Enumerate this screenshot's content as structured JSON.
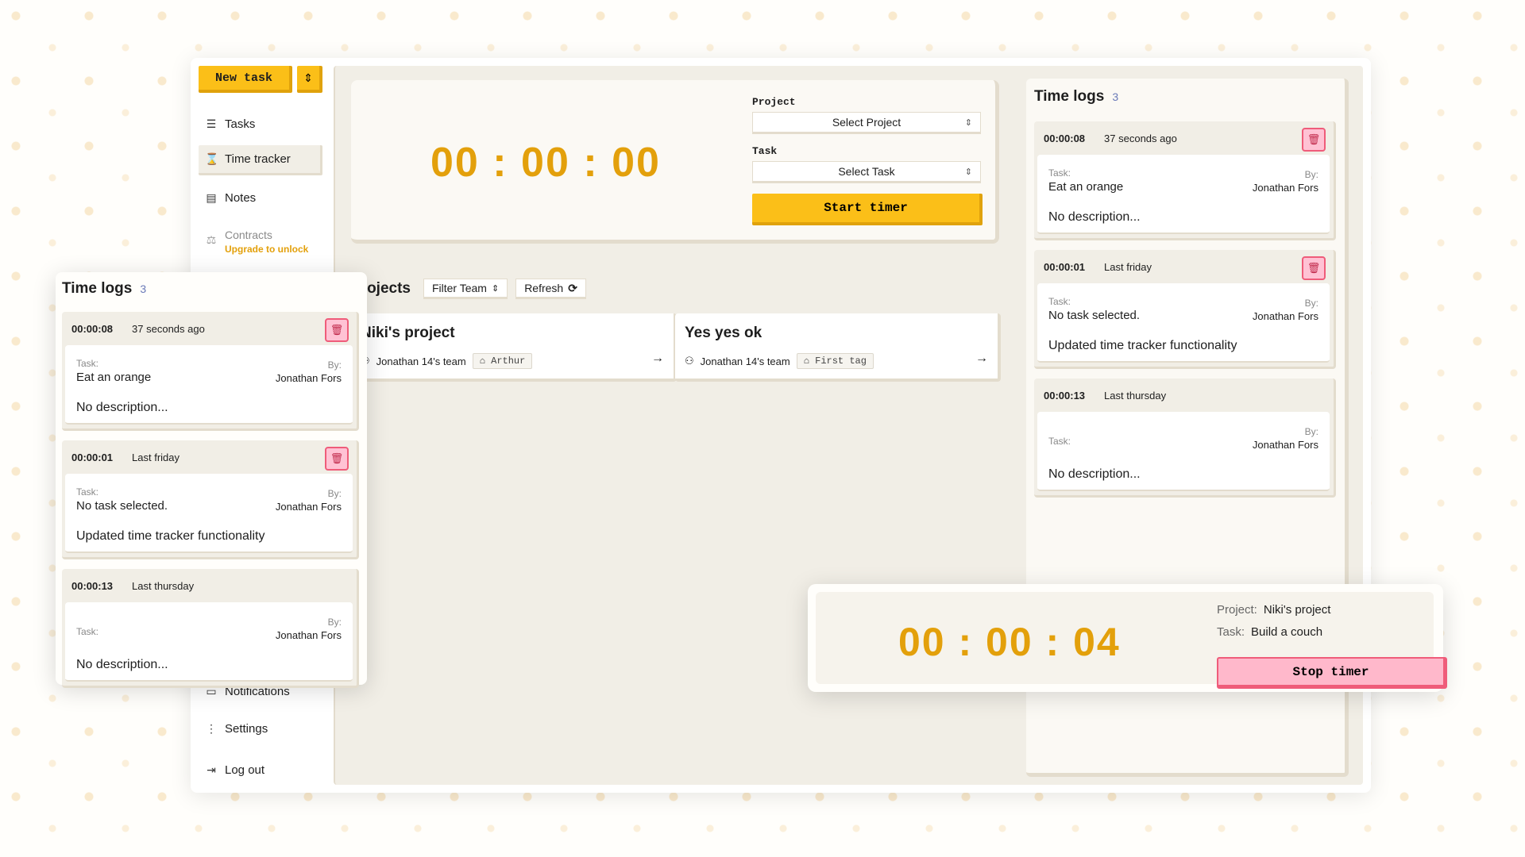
{
  "sidebar": {
    "new_task_label": "New task",
    "items": [
      {
        "label": "Tasks",
        "icon": "list-icon"
      },
      {
        "label": "Time tracker",
        "icon": "hourglass-icon"
      },
      {
        "label": "Notes",
        "icon": "notes-icon"
      },
      {
        "label": "Contracts",
        "icon": "scale-icon",
        "sublabel": "Upgrade to unlock"
      },
      {
        "label": "Notifications",
        "icon": "chat-icon"
      },
      {
        "label": "Settings",
        "icon": "dots-icon"
      },
      {
        "label": "Log out",
        "icon": "logout-icon"
      }
    ]
  },
  "timer": {
    "display": "00 : 00 : 00",
    "project_label": "Project",
    "project_placeholder": "Select Project",
    "task_label": "Task",
    "task_placeholder": "Select Task",
    "start_label": "Start timer"
  },
  "projects": {
    "title": "Projects",
    "filter_label": "Filter Team",
    "refresh_label": "Refresh",
    "items": [
      {
        "name": "Niki's project",
        "team": "Jonathan 14's team",
        "tag": "Arthur"
      },
      {
        "name": "Yes yes ok",
        "team": "Jonathan 14's team",
        "tag": "First tag"
      }
    ]
  },
  "time_logs": {
    "title": "Time logs",
    "count": "3",
    "task_label": "Task:",
    "by_label": "By:",
    "entries": [
      {
        "duration": "00:00:08",
        "when": "37 seconds ago",
        "task": "Eat an orange",
        "by": "Jonathan Fors",
        "description": "No description..."
      },
      {
        "duration": "00:00:01",
        "when": "Last friday",
        "task": "No task selected.",
        "by": "Jonathan Fors",
        "description": "Updated time tracker functionality"
      },
      {
        "duration": "00:00:13",
        "when": "Last thursday",
        "task": "",
        "by": "Jonathan Fors",
        "description": "No description..."
      }
    ]
  },
  "running_timer": {
    "display": "00 : 00 : 04",
    "project_label": "Project:",
    "project": "Niki's project",
    "task_label": "Task:",
    "task": "Build a couch",
    "stop_label": "Stop timer"
  },
  "colors": {
    "accent": "#fbbf18",
    "timer_text": "#e3a00b",
    "danger": "#ef5c7a",
    "panel": "#f1eee6"
  }
}
